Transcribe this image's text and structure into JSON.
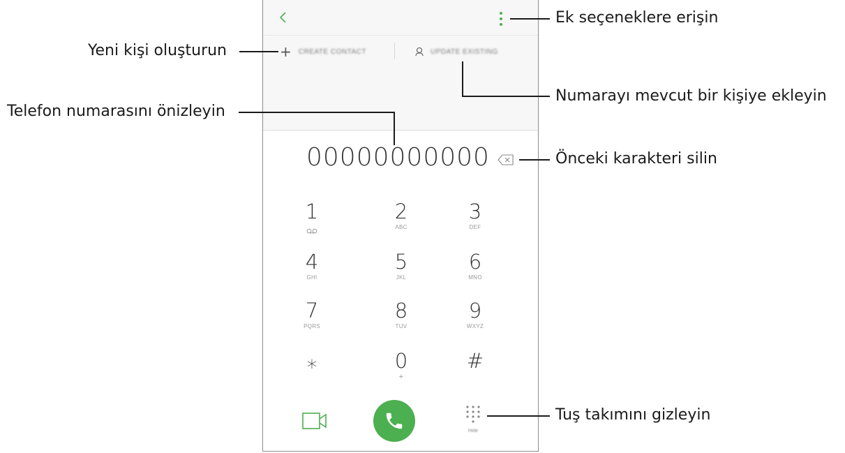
{
  "phone": {
    "action_create": "CREATE CONTACT",
    "action_update": "UPDATE EXISTING",
    "number": "00000000000",
    "keys": [
      {
        "digit": "1",
        "letters": ""
      },
      {
        "digit": "2",
        "letters": "ABC"
      },
      {
        "digit": "3",
        "letters": "DEF"
      },
      {
        "digit": "4",
        "letters": "GHI"
      },
      {
        "digit": "5",
        "letters": "JKL"
      },
      {
        "digit": "6",
        "letters": "MNO"
      },
      {
        "digit": "7",
        "letters": "PQRS"
      },
      {
        "digit": "8",
        "letters": "TUV"
      },
      {
        "digit": "9",
        "letters": "WXYZ"
      },
      {
        "digit": "⁎",
        "letters": ""
      },
      {
        "digit": "0",
        "letters": "+"
      },
      {
        "digit": "#",
        "letters": ""
      }
    ],
    "hide_label": "Hide",
    "accent_color": "#4caf50"
  },
  "callouts": {
    "more_options": "Ek seçeneklere erişin",
    "create_contact": "Yeni kişi oluşturun",
    "add_existing": "Numarayı mevcut bir kişiye ekleyin",
    "preview_number": "Telefon numarasını önizleyin",
    "delete_char": "Önceki karakteri silin",
    "hide_keypad": "Tuş takımını gizleyin"
  },
  "icons": [
    "back-icon",
    "more-options-icon",
    "plus-icon",
    "contact-icon",
    "backspace-icon",
    "voicemail-icon",
    "video-call-icon",
    "phone-icon",
    "keypad-icon"
  ]
}
